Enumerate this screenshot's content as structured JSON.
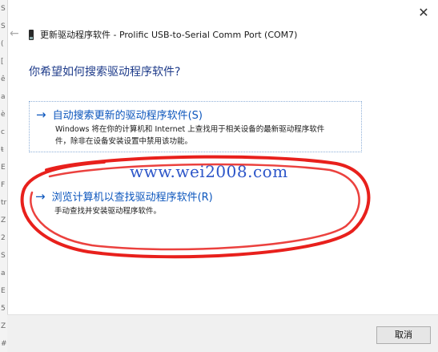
{
  "window": {
    "close_symbol": "✕",
    "back_symbol": "←",
    "title": "更新驱动程序软件 - Prolific USB-to-Serial Comm Port (COM7)"
  },
  "left_strip_glyphs": [
    "S",
    "S",
    "(",
    "[",
    "ê",
    "a",
    "è",
    "c",
    "ŧ",
    "E",
    "F",
    "tr",
    "Z",
    "2",
    "S",
    "a",
    "E",
    "5",
    "Z",
    "#"
  ],
  "question": "你希望如何搜索驱动程序软件?",
  "options": [
    {
      "arrow": "→",
      "title": "自动搜索更新的驱动程序软件(S)",
      "description_line1": "Windows 将在你的计算机和 Internet 上查找用于相关设备的最新驱动程序软件",
      "description_line2": "件，除非在设备安装设置中禁用该功能。"
    },
    {
      "arrow": "→",
      "title": "浏览计算机以查找驱动程序软件(R)",
      "description_line1": "手动查找并安装驱动程序软件。"
    }
  ],
  "watermark": "www.wei2008.com",
  "footer": {
    "cancel_label": "取消"
  },
  "colors": {
    "link": "#0c56bd",
    "question": "#1e3b8a",
    "annotation": "#e8201c"
  }
}
